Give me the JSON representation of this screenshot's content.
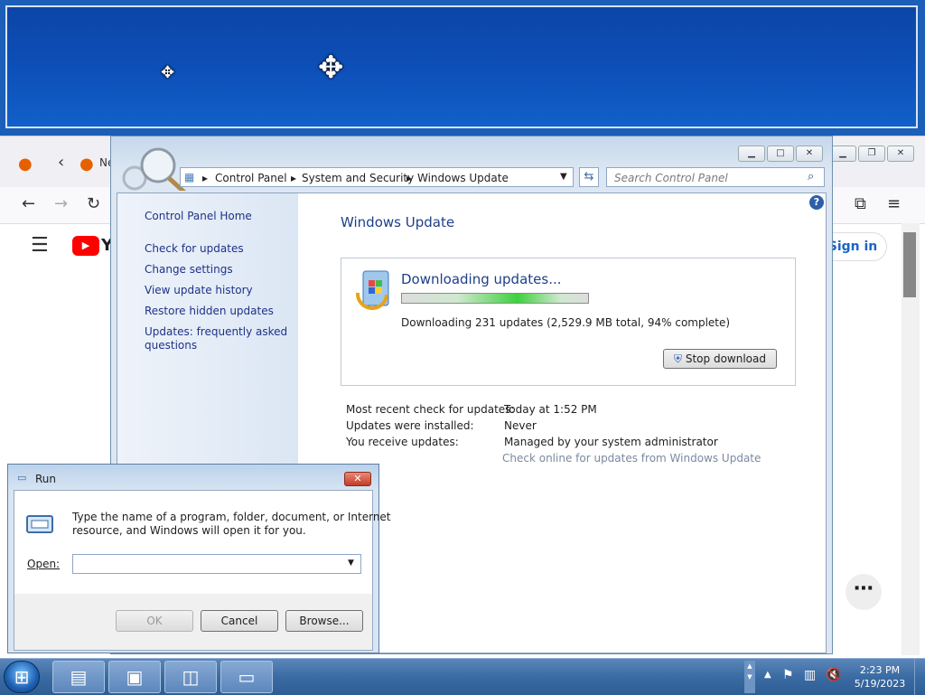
{
  "colors": {
    "desktop_blue": "#1b5fb8",
    "link": "#1e3287",
    "heading": "#1e3f8a",
    "accent_blue": "#1a64c8"
  },
  "icons": {
    "move_cursor": "move-cursor-icon",
    "firefox": "firefox-icon",
    "youtube": "youtube-logo-icon",
    "windows_update": "windows-update-icon",
    "shield": "uac-shield-icon",
    "run": "run-icon",
    "start": "windows-start-orb-icon"
  },
  "browser": {
    "tab_label_fragment": "Ne",
    "youtube_fragment": "Y",
    "sign_in": "Sign in",
    "more": "⋯"
  },
  "control_panel": {
    "breadcrumbs": [
      "Control Panel",
      "System and Security",
      "Windows Update"
    ],
    "search_placeholder": "Search Control Panel",
    "nav_home": "Control Panel Home",
    "nav_links": [
      "Check for updates",
      "Change settings",
      "View update history",
      "Restore hidden updates",
      "Updates: frequently asked",
      "questions"
    ],
    "title": "Windows Update",
    "download": {
      "heading": "Downloading updates...",
      "progress_percent": 94,
      "status": "Downloading 231 updates (2,529.9 MB total, 94% complete)",
      "stop_button": "Stop download"
    },
    "info": {
      "recent_check_label": "Most recent check for updates:",
      "recent_check_value": "Today at 1:52 PM",
      "installed_label": "Updates were installed:",
      "installed_value": "Never",
      "receive_label": "You receive updates:",
      "receive_value": "Managed by your system administrator",
      "check_online": "Check online for updates from Windows Update"
    }
  },
  "run_dialog": {
    "title": "Run",
    "description_line1": "Type the name of a program, folder, document, or Internet",
    "description_line2": "resource, and Windows will open it for you.",
    "open_label": "Open:",
    "open_value": "",
    "ok": "OK",
    "cancel": "Cancel",
    "browse": "Browse..."
  },
  "taskbar": {
    "time": "2:23 PM",
    "date": "5/19/2023"
  }
}
